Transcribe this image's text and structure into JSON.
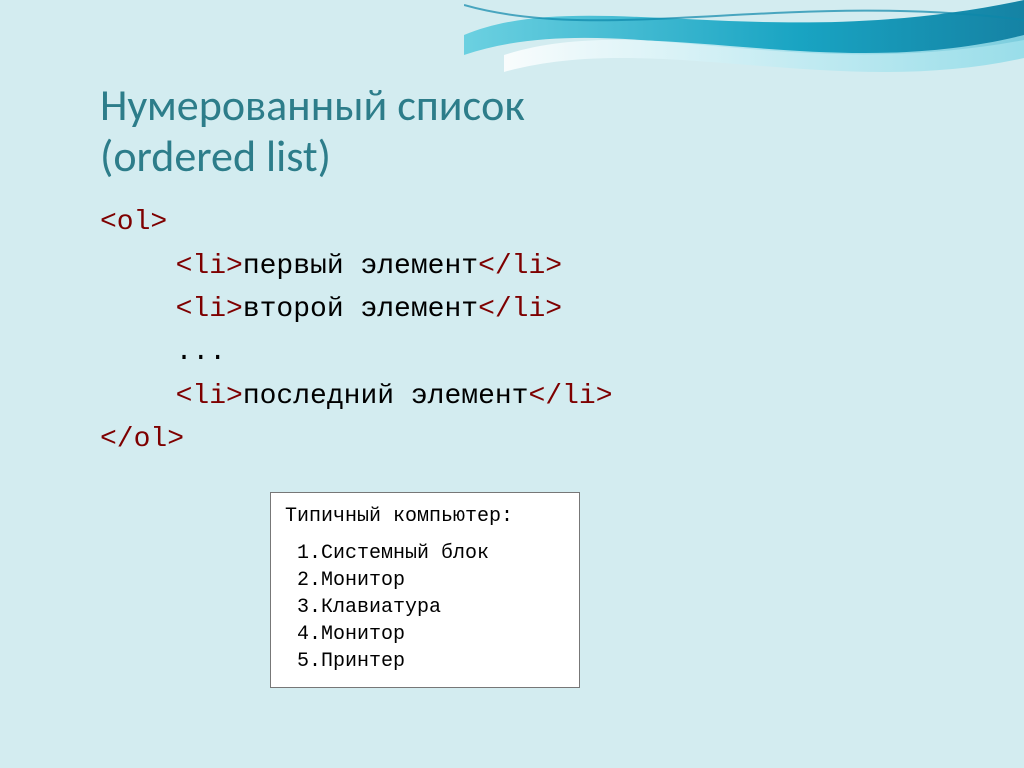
{
  "title_line1": "Нумерованный список",
  "title_line2": "(ordered list)",
  "code": {
    "ol_open": "<ol>",
    "li_open": "<li>",
    "li_close": "</li>",
    "item1": "первый элемент",
    "item2": "второй элемент",
    "ellipsis": "...",
    "item_last": "последний элемент",
    "ol_close": "</ol>"
  },
  "example": {
    "header": "Типичный компьютер:",
    "items": [
      "Системный блок",
      "Монитор",
      "Клавиатура",
      "Монитор",
      "Принтер"
    ]
  }
}
